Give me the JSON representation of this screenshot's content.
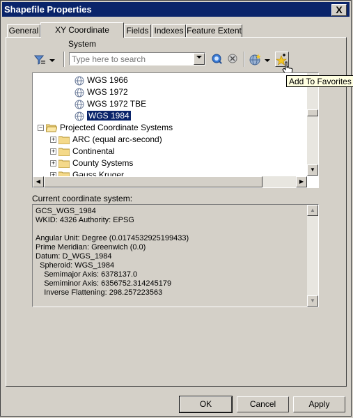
{
  "window": {
    "title": "Shapefile Properties",
    "close_glyph": "X"
  },
  "tabs": [
    {
      "label": "General"
    },
    {
      "label": "XY Coordinate System"
    },
    {
      "label": "Fields"
    },
    {
      "label": "Indexes"
    },
    {
      "label": "Feature Extent"
    }
  ],
  "toolbar": {
    "search_placeholder": "Type here to search",
    "filter_icon": "filter-icon",
    "search_icon": "magnifier-icon",
    "clear_icon": "clear-search-icon",
    "globe_icon": "globe-add-icon",
    "favorites_icon": "add-favorite-icon"
  },
  "tooltip": "Add To Favorites",
  "tree": {
    "items": [
      {
        "label": "WGS 1966"
      },
      {
        "label": "WGS 1972"
      },
      {
        "label": "WGS 1972 TBE"
      },
      {
        "label": "WGS 1984",
        "selected": true
      },
      {
        "label": "Projected Coordinate Systems",
        "expanded": true
      },
      {
        "label": "ARC (equal arc-second)"
      },
      {
        "label": "Continental"
      },
      {
        "label": "County Systems"
      },
      {
        "label": "Gauss Kruger"
      }
    ]
  },
  "current": {
    "label": "Current coordinate system:",
    "lines": [
      "GCS_WGS_1984",
      "WKID: 4326 Authority: EPSG",
      "",
      "Angular Unit: Degree (0.0174532925199433)",
      "Prime Meridian: Greenwich (0.0)",
      "Datum: D_WGS_1984",
      "  Spheroid: WGS_1984",
      "    Semimajor Axis: 6378137.0",
      "    Semiminor Axis: 6356752.314245179",
      "    Inverse Flattening: 298.257223563"
    ]
  },
  "buttons": {
    "ok": "OK",
    "cancel": "Cancel",
    "apply": "Apply"
  },
  "colors": {
    "title_bg": "#0a246a",
    "selection": "#0a246a",
    "dialog_bg": "#d4d0c8"
  }
}
